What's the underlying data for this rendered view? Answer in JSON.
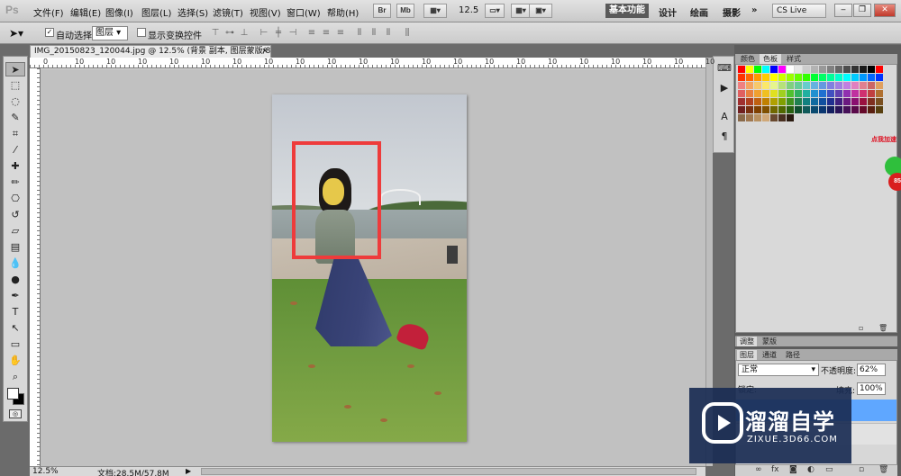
{
  "app": {
    "logo": "Ps"
  },
  "menu": [
    "文件(F)",
    "编辑(E)",
    "图像(I)",
    "图层(L)",
    "选择(S)",
    "滤镜(T)",
    "视图(V)",
    "窗口(W)",
    "帮助(H)"
  ],
  "menubar": {
    "bridge_label": "Br",
    "minibridge_label": "Mb",
    "zoom_level": "12.5",
    "workspaces": {
      "essentials": "基本功能",
      "design": "设计",
      "painting": "绘画",
      "photography": "摄影",
      "more": "»"
    },
    "cs_live": "CS Live"
  },
  "options": {
    "auto_select_label": "自动选择:",
    "auto_select_value": "图层",
    "auto_select_checked": "✓",
    "show_transform_label": "显示变换控件"
  },
  "document": {
    "tab_title": "IMG_20150823_120044.jpg @ 12.5% (背景 副本, 图层蒙版/8) *",
    "close_label": "×",
    "ruler_top_ticks": [
      "0",
      "0",
      "0",
      "0",
      "0",
      "0",
      "0",
      "0",
      "0",
      "0",
      "0",
      "0",
      "0",
      "0",
      "0",
      "0",
      "0",
      "0",
      "0",
      "0",
      "0",
      "0",
      "0",
      "0",
      "0",
      "0",
      "0",
      "0",
      "0",
      "0",
      "0",
      "0",
      "0",
      "0",
      "0",
      "0",
      "0",
      "0",
      "0",
      "0",
      "0",
      "0",
      "0",
      "0",
      "0",
      "0",
      "0",
      "0",
      "0",
      "0",
      "0",
      "0",
      "0",
      "0",
      "0",
      "0",
      "0",
      "0",
      "0",
      "0",
      "0",
      "0",
      "0"
    ],
    "ruler_top_majors": [
      "0",
      "10",
      "10",
      "10",
      "10",
      "10",
      "10",
      "10",
      "10",
      "10",
      "10",
      "10",
      "10",
      "10",
      "10",
      "10",
      "10",
      "10",
      "10",
      "10",
      "10",
      "10",
      "10",
      "10",
      "10"
    ]
  },
  "status": {
    "zoom": "12.5%",
    "doc_size": "文档:28.5M/57.8M",
    "arrow": "▶"
  },
  "panels": {
    "swatches_tabs": [
      "颜色",
      "色板",
      "样式"
    ],
    "adjust_tabs": [
      "调整",
      "蒙版"
    ],
    "layers_tabs": [
      "图层",
      "通道",
      "路径"
    ],
    "blend_mode": "正常",
    "opacity_label": "不透明度:",
    "opacity_value": "62%",
    "lock_label": "锁定:",
    "fill_label": "填充:",
    "fill_value": "100%"
  },
  "ad": {
    "badge": "点我加速",
    "ball_text": "85"
  },
  "watermark": {
    "title": "溜溜自学",
    "url": "ZIXUE.3D66.COM"
  },
  "swatch_colors": [
    "#ff0000",
    "#ffff00",
    "#00ff00",
    "#00ffff",
    "#0000ff",
    "#ff00ff",
    "#ffffff",
    "#e6e6e6",
    "#cccccc",
    "#b3b3b3",
    "#999999",
    "#808080",
    "#666666",
    "#4d4d4d",
    "#333333",
    "#1a1a1a",
    "#000000",
    "#ff0000",
    "#ff3300",
    "#ff6600",
    "#ff9900",
    "#ffcc00",
    "#ffff00",
    "#ccff00",
    "#99ff00",
    "#66ff00",
    "#33ff00",
    "#00ff33",
    "#00ff66",
    "#00ff99",
    "#00ffcc",
    "#00ffff",
    "#00ccff",
    "#0099ff",
    "#0066ff",
    "#0033ff",
    "#f08080",
    "#f4a460",
    "#f7c86b",
    "#fbe86b",
    "#e6f58c",
    "#b6e27a",
    "#7fd07f",
    "#66cc99",
    "#66cccc",
    "#66b2e0",
    "#6699e0",
    "#8080e0",
    "#a080e0",
    "#c080e0",
    "#e080c0",
    "#e08090",
    "#cc6666",
    "#e0a060",
    "#e06060",
    "#e88040",
    "#f0a030",
    "#f0c020",
    "#e0e020",
    "#a0d020",
    "#50c030",
    "#30b060",
    "#20b0a0",
    "#2090d0",
    "#2070d0",
    "#4050c0",
    "#6040b0",
    "#9030b0",
    "#c030a0",
    "#d03070",
    "#c04040",
    "#b07030",
    "#a03030",
    "#b04020",
    "#c06010",
    "#c08000",
    "#b0a000",
    "#80a000",
    "#409020",
    "#208050",
    "#108080",
    "#106aa0",
    "#104f9f",
    "#202f90",
    "#402080",
    "#6a1a80",
    "#8a1070",
    "#9a1040",
    "#803020",
    "#7a5020",
    "#702020",
    "#7a3010",
    "#804000",
    "#805000",
    "#706800",
    "#506800",
    "#286010",
    "#105030",
    "#105a5a",
    "#0a4a70",
    "#0a3670",
    "#141f60",
    "#2a1458",
    "#461058",
    "#5a0a4a",
    "#660a2a",
    "#5a2010",
    "#584010",
    "#8a6a4a",
    "#a07850",
    "#b89060",
    "#d0a878",
    "#6a4a30",
    "#4a3020",
    "#2a1a10"
  ]
}
